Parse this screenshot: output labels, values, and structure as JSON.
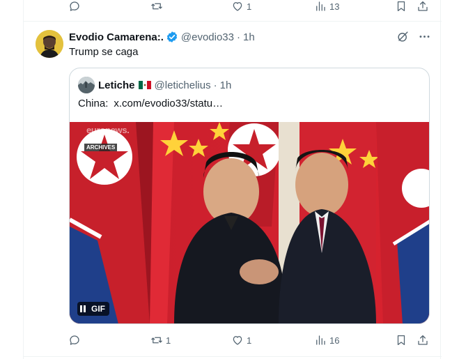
{
  "prev_post_actions": {
    "reply_count": "",
    "repost_count": "",
    "like_count": "1",
    "views_count": "13"
  },
  "post": {
    "display_name": "Evodio Camarena:.",
    "handle": "@evodio33",
    "separator": "·",
    "time": "1h",
    "text": "Trump se caga",
    "quote": {
      "display_name": "Letiche",
      "flag": "mexico-flag",
      "handle": "@letichelius",
      "separator": "·",
      "time": "1h",
      "text_prefix": "China:",
      "link": "x.com/evodio33/statu…",
      "media": {
        "watermark": "euronews.",
        "archives_label": "ARCHIVES",
        "gif_label": "GIF"
      }
    },
    "actions": {
      "reply_count": "",
      "repost_count": "1",
      "like_count": "1",
      "views_count": "16"
    }
  },
  "colors": {
    "text_primary": "#0f1419",
    "text_secondary": "#536471",
    "border": "#cfd9de",
    "divider": "#eff3f4",
    "verified": "#1d9bf0"
  }
}
